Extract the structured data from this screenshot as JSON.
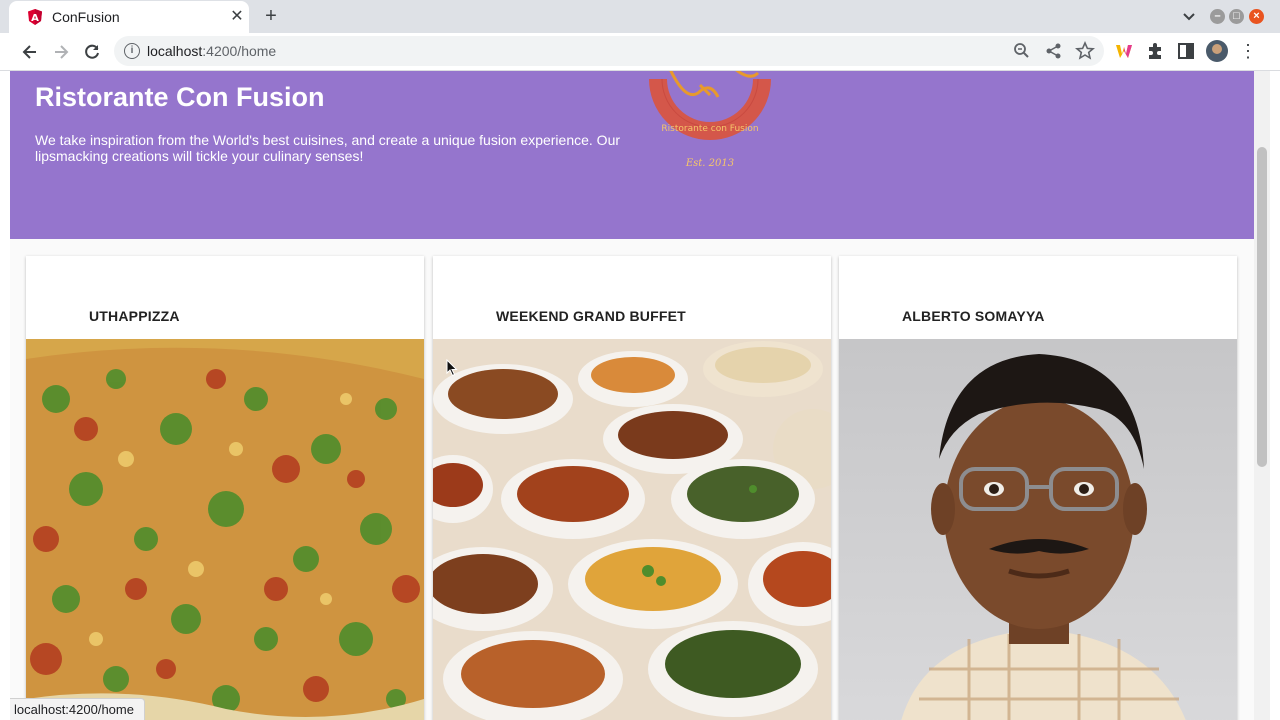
{
  "browser": {
    "tab_title": "ConFusion",
    "tab_close_glyph": "✕",
    "new_tab_glyph": "+",
    "url_host": "localhost",
    "url_rest": ":4200/home",
    "status_url": "localhost:4200/home",
    "icons": [
      "angular-favicon",
      "back-arrow-icon",
      "forward-arrow-icon",
      "reload-icon",
      "site-info-icon",
      "zoom-icon",
      "share-icon",
      "bookmark-star-icon",
      "extension-puzzle-icon",
      "side-panel-icon",
      "profile-avatar",
      "menu-dots-icon"
    ],
    "accent": "#9575cd"
  },
  "jumbotron": {
    "title": "Ristorante Con Fusion",
    "description": "We take inspiration from the World's best cuisines, and create a unique fusion experience. Our lipsmacking creations will tickle your culinary senses!",
    "logo_text": "Ristorante con Fusion",
    "logo_est": "Est. 2013"
  },
  "cards": [
    {
      "title": "UTHAPPIZZA",
      "image": "pizza-photo"
    },
    {
      "title": "WEEKEND GRAND BUFFET",
      "image": "buffet-photo"
    },
    {
      "title": "ALBERTO SOMAYYA",
      "image": "chef-photo"
    }
  ]
}
